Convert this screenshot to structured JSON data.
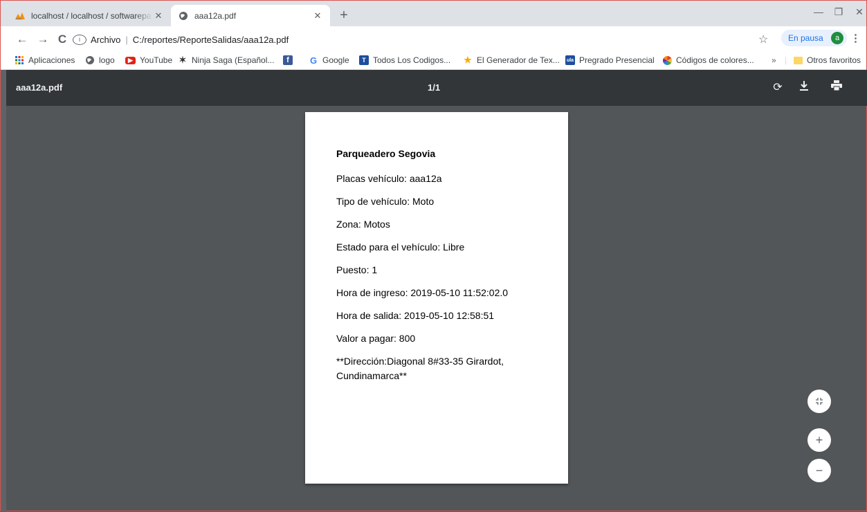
{
  "browser": {
    "tabs": [
      {
        "title": "localhost / localhost / softwarepa",
        "favicon": "phpmyadmin-icon"
      },
      {
        "title": "aaa12a.pdf",
        "favicon": "globe-icon"
      }
    ],
    "url_prefix": "Archivo",
    "url": "C:/reportes/ReporteSalidas/aaa12a.pdf",
    "profile_label": "En pausa",
    "profile_initial": "a"
  },
  "bookmarks": [
    {
      "label": "Aplicaciones",
      "icon": "apps-grid-icon"
    },
    {
      "label": "logo",
      "icon": "globe-icon"
    },
    {
      "label": "YouTube",
      "icon": "youtube-icon"
    },
    {
      "label": "Ninja Saga (Español...",
      "icon": "ninja-icon"
    },
    {
      "label": "",
      "icon": "facebook-icon"
    },
    {
      "label": "Google",
      "icon": "google-icon"
    },
    {
      "label": "Todos Los Codigos...",
      "icon": "tl-icon"
    },
    {
      "label": "El Generador de Tex...",
      "icon": "star-icon"
    },
    {
      "label": "Pregrado Presencial",
      "icon": "university-icon"
    },
    {
      "label": "Códigos de colores...",
      "icon": "color-wheel-icon"
    }
  ],
  "other_bookmarks": "Otros favoritos",
  "more_bookmarks": "»",
  "pdf": {
    "filename": "aaa12a.pdf",
    "page_indicator": "1/1",
    "content": {
      "title": "Parqueadero Segovia",
      "placa": "Placas vehículo: aaa12a",
      "tipo": "Tipo de vehículo: Moto",
      "zona": "Zona: Motos",
      "estado": "Estado para el vehículo: Libre",
      "puesto": "Puesto: 1",
      "ingreso": "Hora de ingreso: 2019-05-10 11:52:02.0",
      "salida": "Hora de salida: 2019-05-10 12:58:51",
      "valor": "Valor a pagar: 800",
      "direccion_1": "**Dirección:Diagonal 8#33-35 Girardot,",
      "direccion_2": "Cundinamarca**"
    }
  }
}
